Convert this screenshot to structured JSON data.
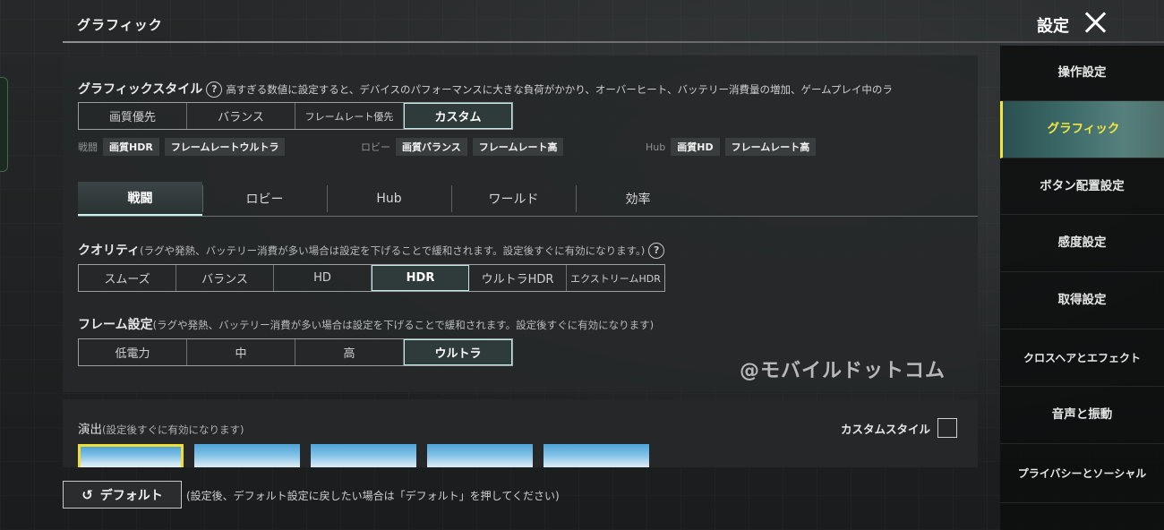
{
  "header": {
    "section_title": "グラフィック",
    "settings_title": "設定"
  },
  "graphics_style": {
    "label": "グラフィックスタイル",
    "help": "?",
    "description": "高すぎる数値に設定すると、デバイスのパフォーマンスに大きな負荷がかかり、オーバーヒート、バッテリー消費量の増加、ゲームプレイ中のラ",
    "options": [
      "画質優先",
      "バランス",
      "フレームレート優先",
      "カスタム"
    ],
    "selected": "カスタム"
  },
  "presets": [
    {
      "label": "戦闘",
      "quality": "画質HDR",
      "frame": "フレームレートウルトラ"
    },
    {
      "label": "ロビー",
      "quality": "画質バランス",
      "frame": "フレームレート高"
    },
    {
      "label": "Hub",
      "quality": "画質HD",
      "frame": "フレームレート高"
    }
  ],
  "tabs": [
    "戦闘",
    "ロビー",
    "Hub",
    "ワールド",
    "効率"
  ],
  "active_tab": "戦闘",
  "quality": {
    "label": "クオリティ",
    "note": "(ラグや発熱、バッテリー消費が多い場合は設定を下げることで緩和されます。設定後すぐに有効になります。)",
    "help": "?",
    "options": [
      "スムーズ",
      "バランス",
      "HD",
      "HDR",
      "ウルトラHDR",
      "エクストリームHDR"
    ],
    "selected": "HDR"
  },
  "frame": {
    "label": "フレーム設定",
    "note": "(ラグや発熱、バッテリー消費が多い場合は設定を下げることで緩和されます。設定後すぐに有効になります)",
    "options": [
      "低電力",
      "中",
      "高",
      "ウルトラ"
    ],
    "selected": "ウルトラ"
  },
  "watermark": "@モバイルドットコム",
  "effects": {
    "label": "演出",
    "note": "(設定後すぐに有効になります)",
    "custom_style_label": "カスタムスタイル",
    "custom_style_checked": false,
    "selected_thumbnail": 1
  },
  "footer": {
    "undo_icon": "↺",
    "default_label": "デフォルト",
    "default_note": "(設定後、デフォルト設定に戻したい場合は「デフォルト」を押してください)"
  },
  "sidenav": {
    "items": [
      "操作設定",
      "グラフィック",
      "ボタン配置設定",
      "感度設定",
      "取得設定",
      "クロスヘアとエフェクト",
      "音声と振動",
      "プライバシーとソーシャル"
    ],
    "active": "グラフィック"
  },
  "colors": {
    "accent_yellow": "#f3e540",
    "selected_border": "#bfe9e6",
    "panel": "#262829"
  }
}
